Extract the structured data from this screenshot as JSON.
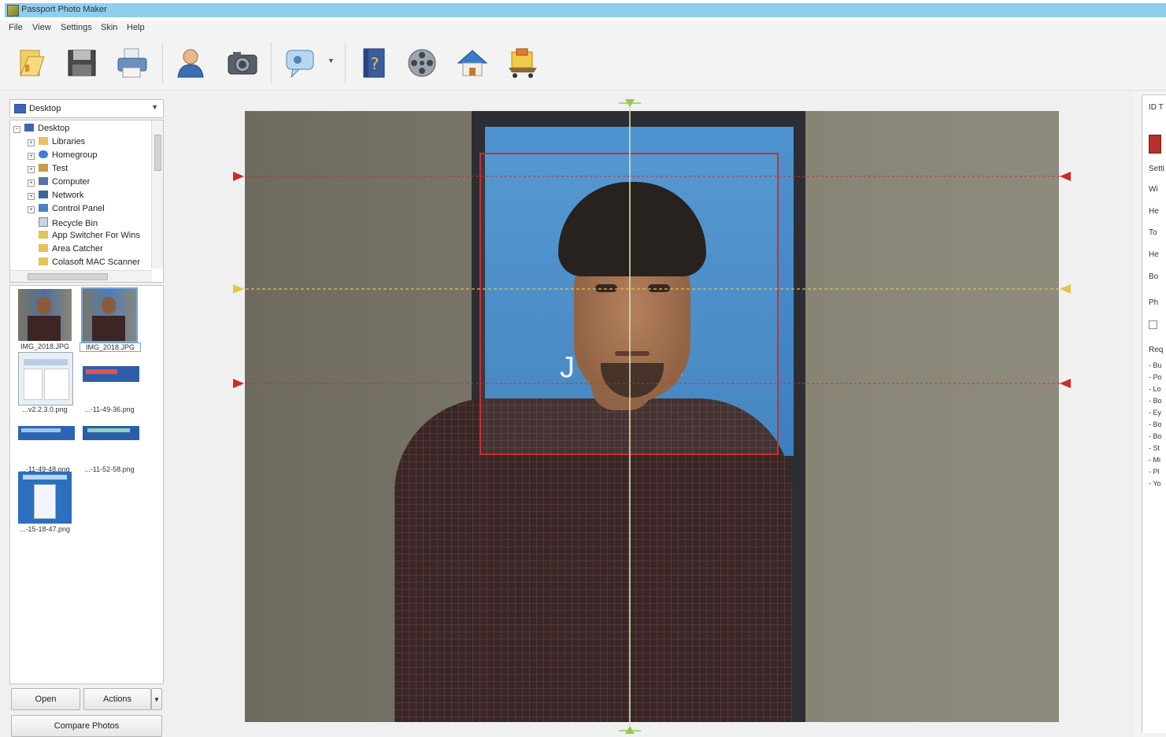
{
  "window": {
    "title": "Passport Photo Maker"
  },
  "menu": [
    "File",
    "View",
    "Settings",
    "Skin",
    "Help"
  ],
  "toolbar": [
    {
      "name": "open-folder-icon"
    },
    {
      "name": "save-icon"
    },
    {
      "name": "print-icon"
    },
    {
      "name": "person-icon"
    },
    {
      "name": "camera-icon"
    },
    {
      "name": "speech-bubble-icon"
    },
    {
      "name": "help-book-icon"
    },
    {
      "name": "film-reel-icon"
    },
    {
      "name": "home-icon"
    },
    {
      "name": "cart-icon"
    }
  ],
  "folder_combo": {
    "value": "Desktop"
  },
  "tree": [
    {
      "label": "Desktop",
      "level": 0,
      "expander": "−",
      "icon": "desktop-icon"
    },
    {
      "label": "Libraries",
      "level": 1,
      "expander": "+",
      "icon": "libraries-icon"
    },
    {
      "label": "Homegroup",
      "level": 1,
      "expander": "+",
      "icon": "homegroup-icon"
    },
    {
      "label": "Test",
      "level": 1,
      "expander": "+",
      "icon": "user-folder-icon"
    },
    {
      "label": "Computer",
      "level": 1,
      "expander": "+",
      "icon": "computer-icon"
    },
    {
      "label": "Network",
      "level": 1,
      "expander": "+",
      "icon": "network-icon"
    },
    {
      "label": "Control Panel",
      "level": 1,
      "expander": "+",
      "icon": "control-panel-icon"
    },
    {
      "label": "Recycle Bin",
      "level": 1,
      "expander": "",
      "icon": "recycle-bin-icon"
    },
    {
      "label": "App Switcher For Wins",
      "level": 1,
      "expander": "",
      "icon": "folder-icon"
    },
    {
      "label": "Area Catcher",
      "level": 1,
      "expander": "",
      "icon": "folder-icon"
    },
    {
      "label": "Colasoft MAC Scanner",
      "level": 1,
      "expander": "",
      "icon": "folder-icon"
    }
  ],
  "thumbnails": [
    {
      "label": "IMG_2018.JPG",
      "kind": "photo",
      "selected": false
    },
    {
      "label": "IMG_2018.JPG",
      "kind": "photo",
      "selected": true
    },
    {
      "label": "...v2.2.3.0.png",
      "kind": "window",
      "selected": false
    },
    {
      "label": "...-11-49-36.png",
      "kind": "banner",
      "selected": false
    },
    {
      "label": "...-11-49-48.png",
      "kind": "banner",
      "selected": false
    },
    {
      "label": "...-11-52-58.png",
      "kind": "banner",
      "selected": false
    },
    {
      "label": "...-15-18-47.png",
      "kind": "bluewindow",
      "selected": false
    }
  ],
  "buttons": {
    "open": "Open",
    "actions": "Actions",
    "compare": "Compare Photos"
  },
  "backdrop_text": "J          re",
  "right_panel": {
    "title": "ID T",
    "labels": [
      "Setti",
      "Wi",
      "He",
      "To",
      "He",
      "Bo",
      "Ph",
      "Req"
    ],
    "requirements": [
      "Bu",
      "Po",
      "Lo",
      "Bo",
      "Ey",
      "Bo",
      "Bo",
      "St",
      "Mi",
      "Pl",
      "Yo"
    ]
  },
  "colors": {
    "title_strip": "#8fcfee",
    "guide_red": "#cc2b2b",
    "guide_yellow": "#e2c544",
    "guide_green": "#8fcc4c",
    "backdrop_blue": "#3f87c7"
  }
}
